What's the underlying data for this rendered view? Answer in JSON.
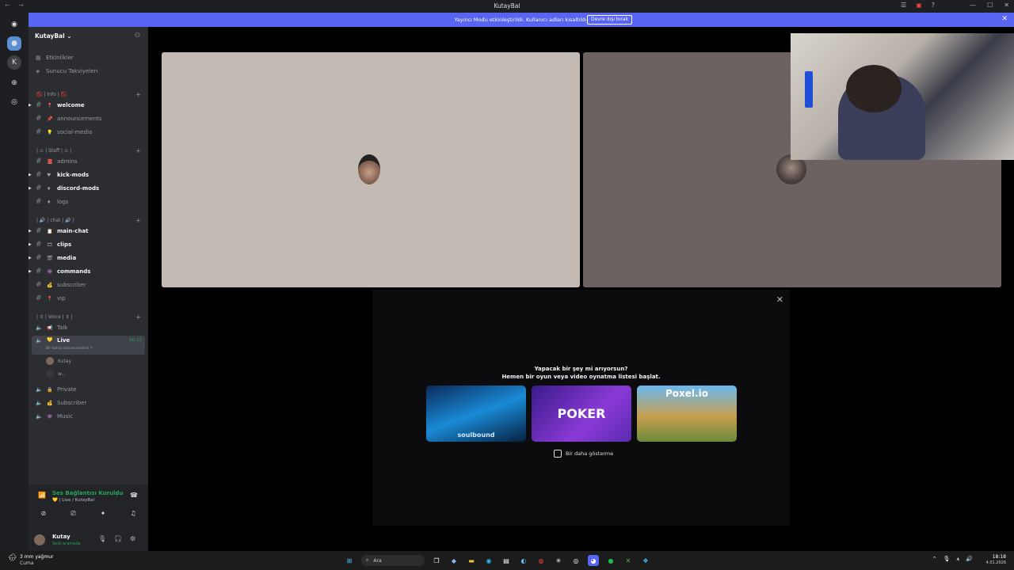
{
  "window": {
    "title": "KutayBal"
  },
  "banner": {
    "message": "Yayıncı Modu etkinleştirildi. Kullanıcı adları kısaltıldı.",
    "button": "Devre dışı bırak"
  },
  "server": {
    "name": "KutayBal ⌄"
  },
  "top_items": [
    {
      "label": "Etkinlikler"
    },
    {
      "label": "Sunucu Takviyeleri"
    }
  ],
  "categories": {
    "info": "🚫 | Info | 🚫",
    "staff": "| ⚠ | Staff | ⚠ |",
    "chat": "| 🔊 | chat | 🔊 |",
    "voice": "| ⇕ | Voice | ⇕ |"
  },
  "channels": [
    {
      "label": "welcome",
      "emoji": "📍",
      "bold": true
    },
    {
      "label": "announcements",
      "emoji": "📌",
      "bold": false
    },
    {
      "label": "social-media",
      "emoji": "💡",
      "bold": false
    },
    {
      "label": "admins",
      "emoji": "📕",
      "bold": false
    },
    {
      "label": "kick-mods",
      "emoji": "♥",
      "bold": true
    },
    {
      "label": "discord-mods",
      "emoji": "♦",
      "bold": true
    },
    {
      "label": "logs",
      "emoji": "♦",
      "bold": false
    },
    {
      "label": "main-chat",
      "emoji": "📋",
      "bold": true
    },
    {
      "label": "clips",
      "emoji": "🎞",
      "bold": true
    },
    {
      "label": "media",
      "emoji": "🎬",
      "bold": true
    },
    {
      "label": "commands",
      "emoji": "👾",
      "bold": true
    },
    {
      "label": "subscriber",
      "emoji": "💰",
      "bold": false
    },
    {
      "label": "vip",
      "emoji": "📍",
      "bold": false
    }
  ],
  "voice_channels": [
    {
      "label": "Talk",
      "emoji": "📢"
    },
    {
      "label": "Live",
      "emoji": "💛",
      "timer": "14:11",
      "status_hint": "Bir kanal durumu belirle ✎"
    },
    {
      "label": "Private",
      "emoji": "🔒"
    },
    {
      "label": "Subscriber",
      "emoji": "💰"
    },
    {
      "label": "Music",
      "emoji": "👾"
    }
  ],
  "voice_users": [
    {
      "name": "Kutay"
    },
    {
      "name": "w..."
    }
  ],
  "voice_panel": {
    "status": "Ses Bağlantısı Kuruldu",
    "channel": "💛 | Live / KutayBal"
  },
  "user": {
    "name": "Kutay",
    "status": "Sesli aramada"
  },
  "activity_popup": {
    "question": "Yapacak bir şey mi arıyorsun?",
    "subtitle": "Hemen bir oyun veya video oynatma listesi başlat.",
    "games": [
      {
        "label": "soulbound"
      },
      {
        "label": "POKER"
      },
      {
        "label": "Poxel.io"
      }
    ],
    "checkbox_label": "Bir daha gösterme"
  },
  "taskbar": {
    "weather": "3 mm yağmur",
    "weather_sub": "Cuma",
    "search_placeholder": "Ara",
    "time": "18:18",
    "date": "4.01.2026"
  },
  "colors": {
    "accent": "#5865f2",
    "online": "#23a559",
    "sidebar": "#2b2d31",
    "guild_bar": "#1e1f22"
  }
}
